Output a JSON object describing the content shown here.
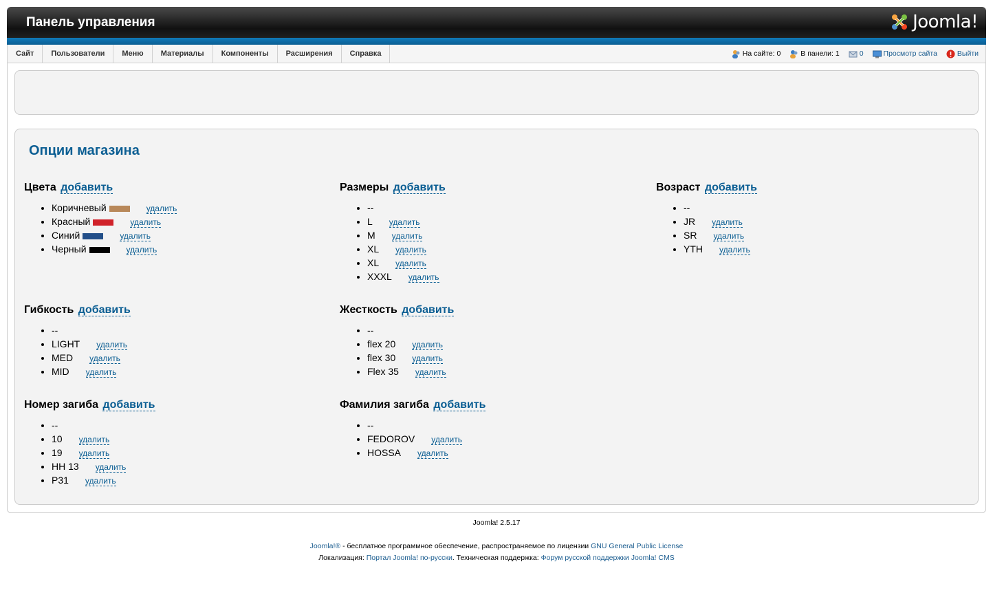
{
  "header": {
    "title": "Панель управления",
    "logo_text": "Joomla!"
  },
  "menu": [
    "Сайт",
    "Пользователи",
    "Меню",
    "Материалы",
    "Компоненты",
    "Расширения",
    "Справка"
  ],
  "status": {
    "on_site": "На сайте: 0",
    "in_panel": "В панели: 1",
    "messages": "0",
    "view_site": "Просмотр сайта",
    "logout": "Выйти"
  },
  "page_title": "Опции магазина",
  "add_label": "добавить",
  "delete_label": "удалить",
  "colors": {
    "accent": "#0b5e93",
    "bluebar": "#0f79b8"
  },
  "groups": {
    "colors": {
      "title": "Цвета",
      "items": [
        {
          "label": "Коричневый",
          "swatch": "#b8885a"
        },
        {
          "label": "Красный",
          "swatch": "#d0222a"
        },
        {
          "label": "Синий",
          "swatch": "#234f89"
        },
        {
          "label": "Черный",
          "swatch": "#000000"
        }
      ]
    },
    "sizes": {
      "title": "Размеры",
      "items": [
        "--",
        "L",
        "M",
        "XL",
        "XL",
        "XXXL"
      ]
    },
    "age": {
      "title": "Возраст",
      "items": [
        "--",
        "JR",
        "SR",
        "YTH"
      ]
    },
    "flex": {
      "title": "Гибкость",
      "items": [
        "--",
        "LIGHT",
        "MED",
        "MID"
      ]
    },
    "stiffness": {
      "title": "Жесткость",
      "items": [
        "--",
        "flex 20",
        "flex 30",
        "Flex 35"
      ]
    },
    "curve_no": {
      "title": "Номер загиба",
      "items": [
        "--",
        "10",
        "19",
        "HH 13",
        "P31"
      ]
    },
    "curve_name": {
      "title": "Фамилия загиба",
      "items": [
        "--",
        "FEDOROV",
        "HOSSA"
      ]
    }
  },
  "footer": {
    "version": "Joomla! 2.5.17",
    "joomla_link": "Joomla!®",
    "license_text": " - бесплатное программное обеспечение, распространяемое по лицензии ",
    "gpl_link": "GNU General Public License",
    "loc_label": "Локализация: ",
    "portal_link": "Портал Joomla! по-русски",
    "support_label": ". Техническая поддержка: ",
    "forum_link": "Форум русской поддержки Joomla! CMS"
  }
}
